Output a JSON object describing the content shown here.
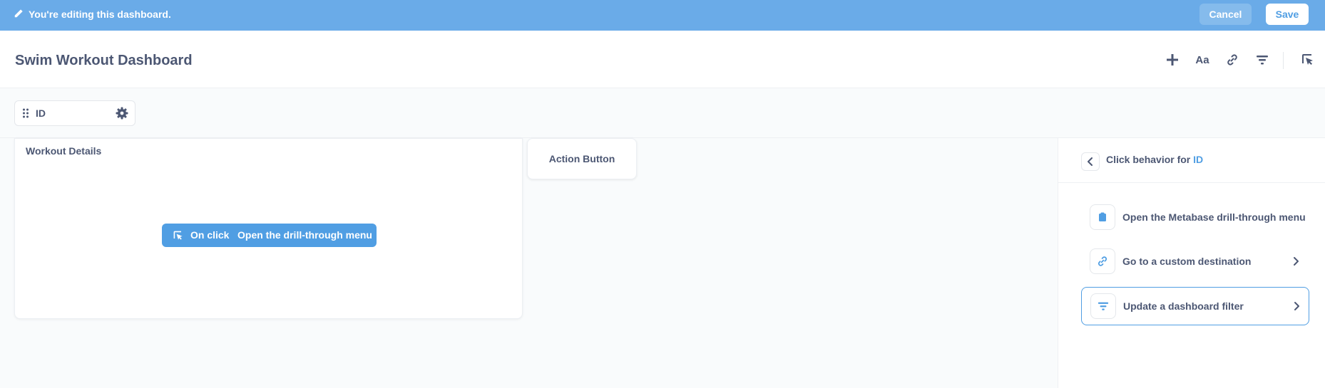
{
  "edit_bar": {
    "message": "You're editing this dashboard.",
    "cancel_label": "Cancel",
    "save_label": "Save",
    "bg_color": "#6aabe8"
  },
  "header": {
    "title": "Swim Workout Dashboard",
    "toolbar_icons": [
      "plus-icon",
      "text-icon",
      "link-icon",
      "filter-icon",
      "click-behavior-icon"
    ],
    "text_icon_label": "Aa"
  },
  "parameter": {
    "label": "ID"
  },
  "cards": {
    "workout": {
      "title": "Workout Details",
      "click_pill": {
        "on_click": "On click",
        "action": "Open the drill-through menu"
      }
    },
    "action_button": {
      "label": "Action Button"
    }
  },
  "sidebar": {
    "title_prefix": "Click behavior for",
    "title_target": "ID",
    "options": [
      {
        "label": "Open the Metabase drill-through menu",
        "icon": "clipboard-icon",
        "selected": false
      },
      {
        "label": "Go to a custom destination",
        "icon": "link-icon",
        "selected": false
      },
      {
        "label": "Update a dashboard filter",
        "icon": "filter-icon",
        "selected": true
      }
    ]
  },
  "colors": {
    "brand": "#509ee3",
    "text": "#4c5773",
    "border": "#e4e7eb"
  }
}
